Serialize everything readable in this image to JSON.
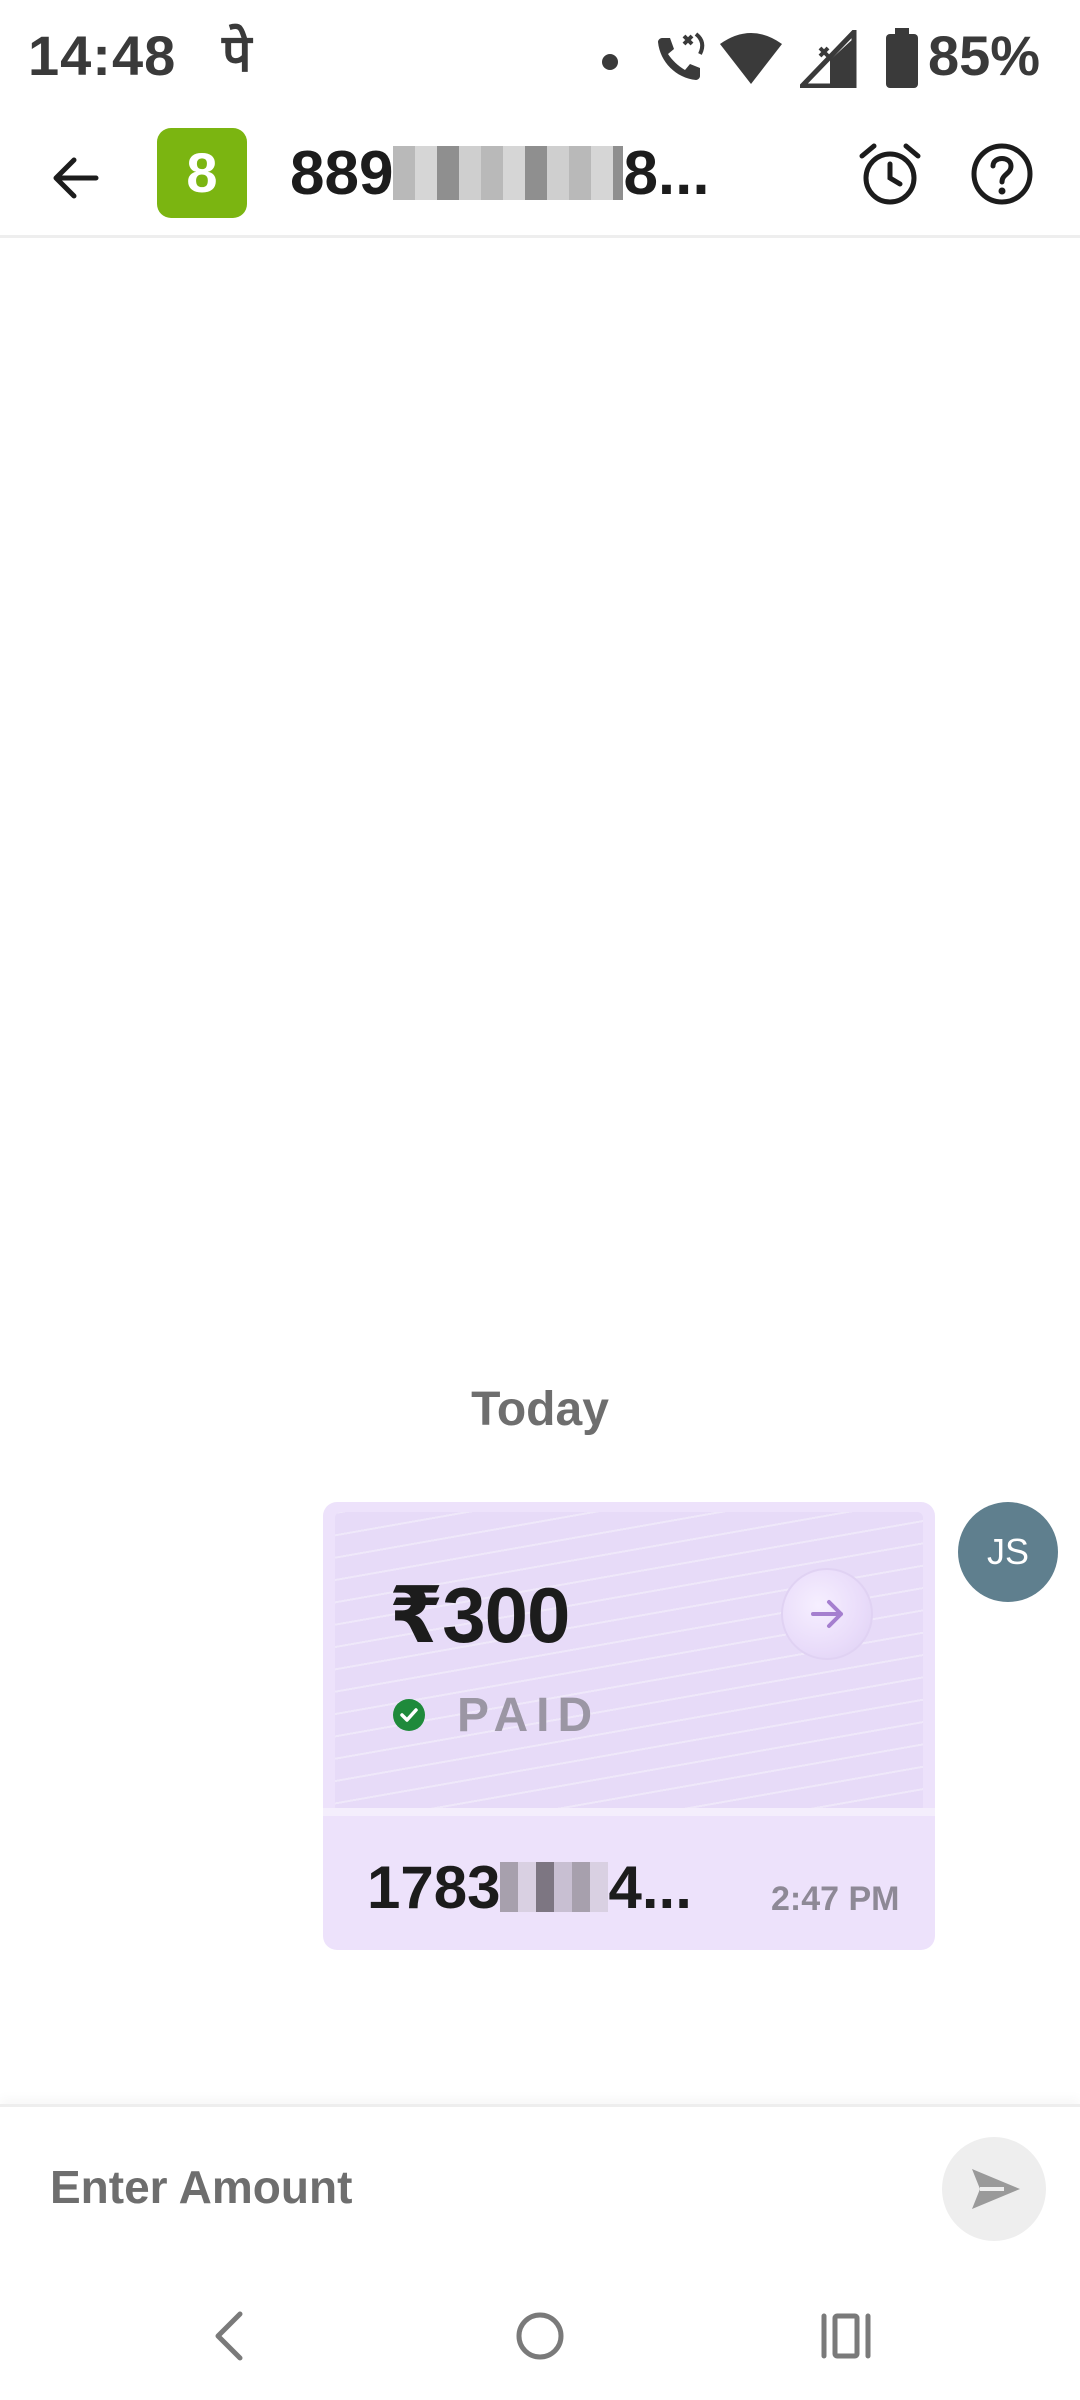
{
  "status_bar": {
    "time": "14:48",
    "app_indicator": "पे",
    "battery_percent": "85%",
    "icons": [
      "notification-dot-icon",
      "wifi-calling-icon",
      "wifi-icon",
      "signal-icon",
      "battery-icon"
    ]
  },
  "header": {
    "avatar_letter": "8",
    "avatar_color": "#7bb511",
    "contact_prefix": "889",
    "contact_suffix": "8...",
    "icons": [
      "back-arrow-icon",
      "alarm-clock-icon",
      "help-circle-icon"
    ]
  },
  "chat": {
    "date_label": "Today",
    "messages": [
      {
        "amount": "₹300",
        "status": "PAID",
        "status_color": "#1f8a3b",
        "txn_prefix": "1783",
        "txn_suffix": "4...",
        "time": "2:47 PM",
        "sender_initials": "JS",
        "card_color": "#ede2fb"
      }
    ]
  },
  "input": {
    "placeholder": "Enter Amount"
  },
  "nav": {
    "icons": [
      "nav-back-icon",
      "nav-home-icon",
      "nav-recents-icon"
    ]
  }
}
